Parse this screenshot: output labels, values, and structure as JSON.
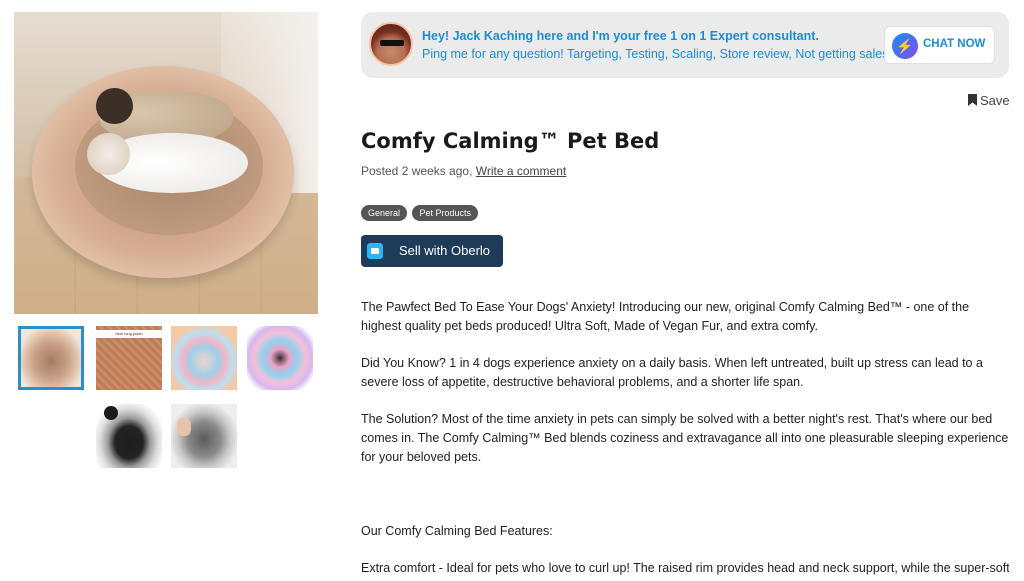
{
  "banner": {
    "line1": "Hey! Jack Kaching here and I'm your free 1 on 1 Expert consultant.",
    "line2": "Ping me for any question! Targeting, Testing, Scaling, Store review, Not getting sales?",
    "chat_label": "CHAT NOW",
    "avatar_icon": "avatar-glasses",
    "messenger_icon": "messenger-icon"
  },
  "save_label": "Save",
  "product": {
    "title": "Comfy Calming™ Pet Bed",
    "posted_prefix": "Posted 2 weeks ago, ",
    "comment_link": "Write a comment",
    "tags": [
      "General",
      "Pet Products"
    ],
    "oberlo_label": "Sell with Oberlo"
  },
  "gallery": {
    "thumb2_caption": "Item long plush"
  },
  "description": {
    "p1": "The Pawfect Bed To Ease Your Dogs' Anxiety! Introducing our new, original Comfy Calming Bed™ - one of the highest quality pet beds produced! Ultra Soft, Made of Vegan Fur, and extra comfy.",
    "p2": "Did You Know? 1 in 4 dogs experience anxiety on a daily basis. When left untreated, built up stress can lead to a severe loss of appetite, destructive behavioral problems, and a shorter life span.",
    "p3": "The Solution? Most of the time anxiety in pets can simply be solved with a better night's rest. That's where our bed comes in. The Comfy Calming™ Bed blends coziness and extravagance all into one pleasurable sleeping experience for your beloved pets.",
    "features_heading": "Our Comfy Calming Bed Features:",
    "extra": "Extra comfort - Ideal for pets who love to curl up! The raised rim provides head and neck support, while the super-soft"
  },
  "colors": {
    "accent_blue": "#1b8cd8",
    "oberlo_bg": "#1f3b5a",
    "tag_bg": "#555555",
    "selected_border": "#2c8fc7"
  }
}
